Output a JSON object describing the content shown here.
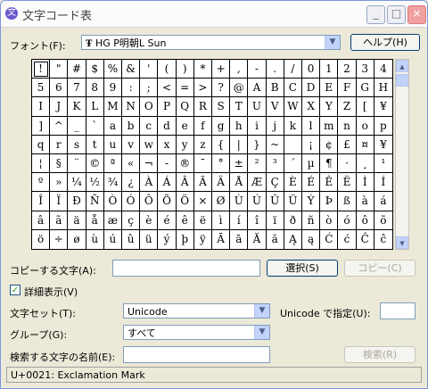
{
  "window": {
    "title": "文字コード表",
    "icon": "charmap-app-icon",
    "controls": {
      "minimize": "_",
      "maximize": "□",
      "close": "×"
    }
  },
  "font_row": {
    "label": "フォント(F):",
    "font_icon": "TrueType",
    "font_value": "HG P明朝L Sun",
    "help_button": "ヘルプ(H)"
  },
  "char_grid": {
    "selected": "!",
    "rows": [
      [
        "!",
        "\"",
        "#",
        "$",
        "%",
        "&",
        "'",
        "(",
        ")",
        "*",
        "+",
        ",",
        "-",
        ".",
        "/",
        "0",
        "1",
        "2",
        "3",
        "4"
      ],
      [
        "5",
        "6",
        "7",
        "8",
        "9",
        ":",
        ";",
        "<",
        "=",
        ">",
        "?",
        "@",
        "A",
        "B",
        "C",
        "D",
        "E",
        "F",
        "G",
        "H"
      ],
      [
        "I",
        "J",
        "K",
        "L",
        "M",
        "N",
        "O",
        "P",
        "Q",
        "R",
        "S",
        "T",
        "U",
        "V",
        "W",
        "X",
        "Y",
        "Z",
        "[",
        "¥"
      ],
      [
        "]",
        "^",
        "_",
        "`",
        "a",
        "b",
        "c",
        "d",
        "e",
        "f",
        "g",
        "h",
        "i",
        "j",
        "k",
        "l",
        "m",
        "n",
        "o",
        "p"
      ],
      [
        "q",
        "r",
        "s",
        "t",
        "u",
        "v",
        "w",
        "x",
        "y",
        "z",
        "{",
        "|",
        "}",
        "~",
        "",
        "¡",
        "¢",
        "£",
        "¤",
        "¥"
      ],
      [
        "¦",
        "§",
        "¨",
        "©",
        "ª",
        "«",
        "¬",
        "-",
        "®",
        "¯",
        "°",
        "±",
        "²",
        "³",
        "´",
        "µ",
        "¶",
        "·",
        "¸",
        "¹"
      ],
      [
        "º",
        "»",
        "¼",
        "½",
        "¾",
        "¿",
        "À",
        "Á",
        "Â",
        "Ã",
        "Ä",
        "Å",
        "Æ",
        "Ç",
        "È",
        "É",
        "Ê",
        "Ë",
        "Ì",
        "Í"
      ],
      [
        "Î",
        "Ï",
        "Ð",
        "Ñ",
        "Ò",
        "Ó",
        "Ô",
        "Õ",
        "Ö",
        "×",
        "Ø",
        "Ù",
        "Ú",
        "Û",
        "Ü",
        "Ý",
        "Þ",
        "ß",
        "à",
        "á"
      ],
      [
        "â",
        "ã",
        "ä",
        "å",
        "æ",
        "ç",
        "è",
        "é",
        "ê",
        "ë",
        "ì",
        "í",
        "î",
        "ï",
        "ð",
        "ñ",
        "ò",
        "ó",
        "ô",
        "õ"
      ],
      [
        "ö",
        "÷",
        "ø",
        "ù",
        "ú",
        "û",
        "ü",
        "ý",
        "þ",
        "ÿ",
        "Ā",
        "ā",
        "Ă",
        "ă",
        "Ą",
        "ą",
        "Ć",
        "ć",
        "Ĉ",
        "ĉ"
      ]
    ]
  },
  "copy_row": {
    "label": "コピーする文字(A):",
    "value": "",
    "select_button": "選択(S)",
    "copy_button": "コピー(C)"
  },
  "advanced": {
    "checked": true,
    "label": "詳細表示(V)"
  },
  "charset_row": {
    "label": "文字セット(T):",
    "value": "Unicode",
    "unicode_label": "Unicode で指定(U):",
    "unicode_value": ""
  },
  "group_row": {
    "label": "グループ(G):",
    "value": "すべて"
  },
  "search_row": {
    "label": "検索する文字の名前(E):",
    "value": "",
    "search_button": "検索(R)"
  },
  "status": {
    "text": "U+0021: Exclamation Mark"
  }
}
